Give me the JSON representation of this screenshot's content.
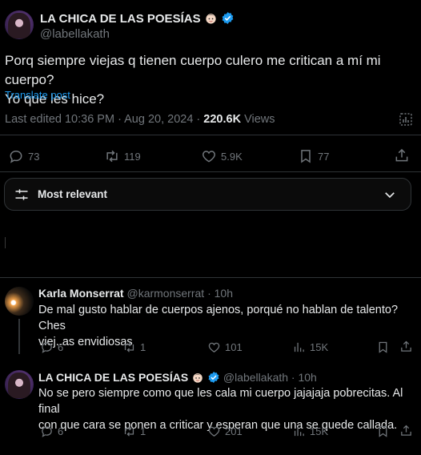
{
  "post": {
    "author_name": "LA CHICA DE LAS POESÍAS",
    "author_handle": "@labellakath",
    "text_line1": "Porq siempre viejas q tienen cuerpo culero me critican a mí mi cuerpo?",
    "text_line2": "Yo que les hice?",
    "translate": "Translate post",
    "edited": "Last edited 10:36 PM · Aug 20, 2024 · ",
    "views_count": "220.6K",
    "views_label": " Views",
    "replies": "73",
    "reposts": "119",
    "likes": "5.9K",
    "bookmarks": "77"
  },
  "sort": {
    "label": "Most relevant"
  },
  "replies": [
    {
      "name": "Karla Monserrat",
      "handle": "@karmonserrat",
      "dot": "·",
      "time": "10h",
      "line1": "De mal gusto hablar de cuerpos ajenos, porqué no hablan de talento? Ches",
      "line2": "viej..as envidiosas",
      "replies": "6",
      "reposts": "1",
      "likes": "101",
      "views": "15K"
    },
    {
      "name": "LA CHICA DE LAS POESÍAS",
      "handle": "@labellakath",
      "dot": "·",
      "time": "10h",
      "line1": "No se pero siempre como que les cala mi cuerpo jajajaja pobrecitas. Al final",
      "line2": "con que cara se ponen a criticar y esperan que una se quede callada.",
      "replies": "6",
      "reposts": "1",
      "likes": "201",
      "views": "15K"
    }
  ],
  "colors": {
    "accent": "#1d9bf0",
    "text": "#e7e9ea",
    "muted": "#71767b",
    "border": "#2f3336"
  },
  "icons": [
    "verified-badge-icon",
    "face-emoji-icon",
    "reply-icon",
    "repost-icon",
    "like-icon",
    "bookmark-icon",
    "views-icon",
    "share-icon",
    "filter-icon",
    "chevron-down-icon",
    "analytics-icon"
  ]
}
